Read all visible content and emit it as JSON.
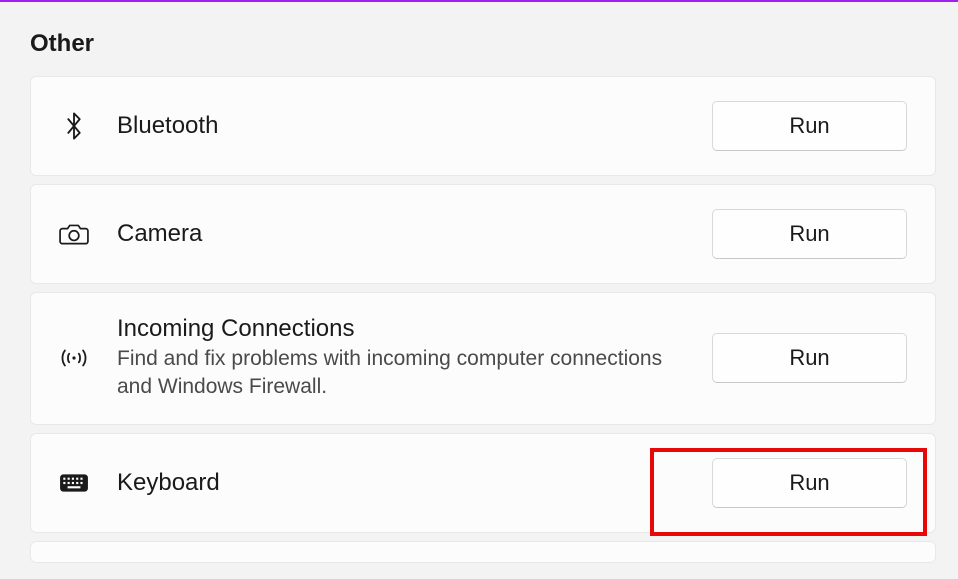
{
  "section": {
    "header": "Other"
  },
  "items": [
    {
      "id": "bluetooth",
      "title": "Bluetooth",
      "description": null,
      "button": "Run",
      "icon": "bluetooth-icon"
    },
    {
      "id": "camera",
      "title": "Camera",
      "description": null,
      "button": "Run",
      "icon": "camera-icon"
    },
    {
      "id": "incoming-connections",
      "title": "Incoming Connections",
      "description": "Find and fix problems with incoming computer connections and Windows Firewall.",
      "button": "Run",
      "icon": "antenna-icon"
    },
    {
      "id": "keyboard",
      "title": "Keyboard",
      "description": null,
      "button": "Run",
      "icon": "keyboard-icon"
    }
  ]
}
